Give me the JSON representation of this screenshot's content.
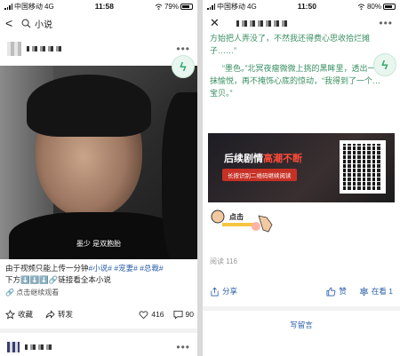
{
  "left": {
    "status": {
      "carrier": "中国移动",
      "network": "4G",
      "time": "11:58",
      "battery": "79%",
      "battery_level": 0.79
    },
    "search": {
      "query": "小说"
    },
    "video": {
      "subtitle": "墨少 是双胞胎"
    },
    "post": {
      "caption_text": "由于视频只能上传一分钟",
      "tags": [
        "#小说#",
        "#宠妻#",
        "#总裁#"
      ],
      "caption_line2": "下方⬇️⬇️⬇️🔗链接看全本小说",
      "continue_link": "点击继续观看"
    },
    "actions": {
      "collect": "收藏",
      "forward": "转发",
      "likes": "416",
      "comments": "90"
    }
  },
  "right": {
    "status": {
      "carrier": "中国移动",
      "network": "4G",
      "time": "11:50",
      "battery": "80%",
      "battery_level": 0.8
    },
    "article": {
      "p1": "方始把人弄没了，不然我还得费心思收拾烂摊子……”",
      "p2": "“墨色。”北冥夜瘤微微上挑的黑眸里，透出一抹愉悦，再不掩饰心底的惊动，“我得到了一个…宝贝。”"
    },
    "banner": {
      "title_white": "后续剧情",
      "title_red": "高潮不断",
      "pill": "长按识别二维码继续阅读"
    },
    "tap_hint": "点击",
    "read_count": "阅读 116",
    "actions": {
      "share": "分享",
      "like": "赞",
      "looking": "在看 1"
    },
    "write_comment": "写留言"
  },
  "colors": {
    "tag_blue": "#2a5ea8",
    "article_green": "#3a8f62",
    "banner_red": "#ff4b3a"
  }
}
